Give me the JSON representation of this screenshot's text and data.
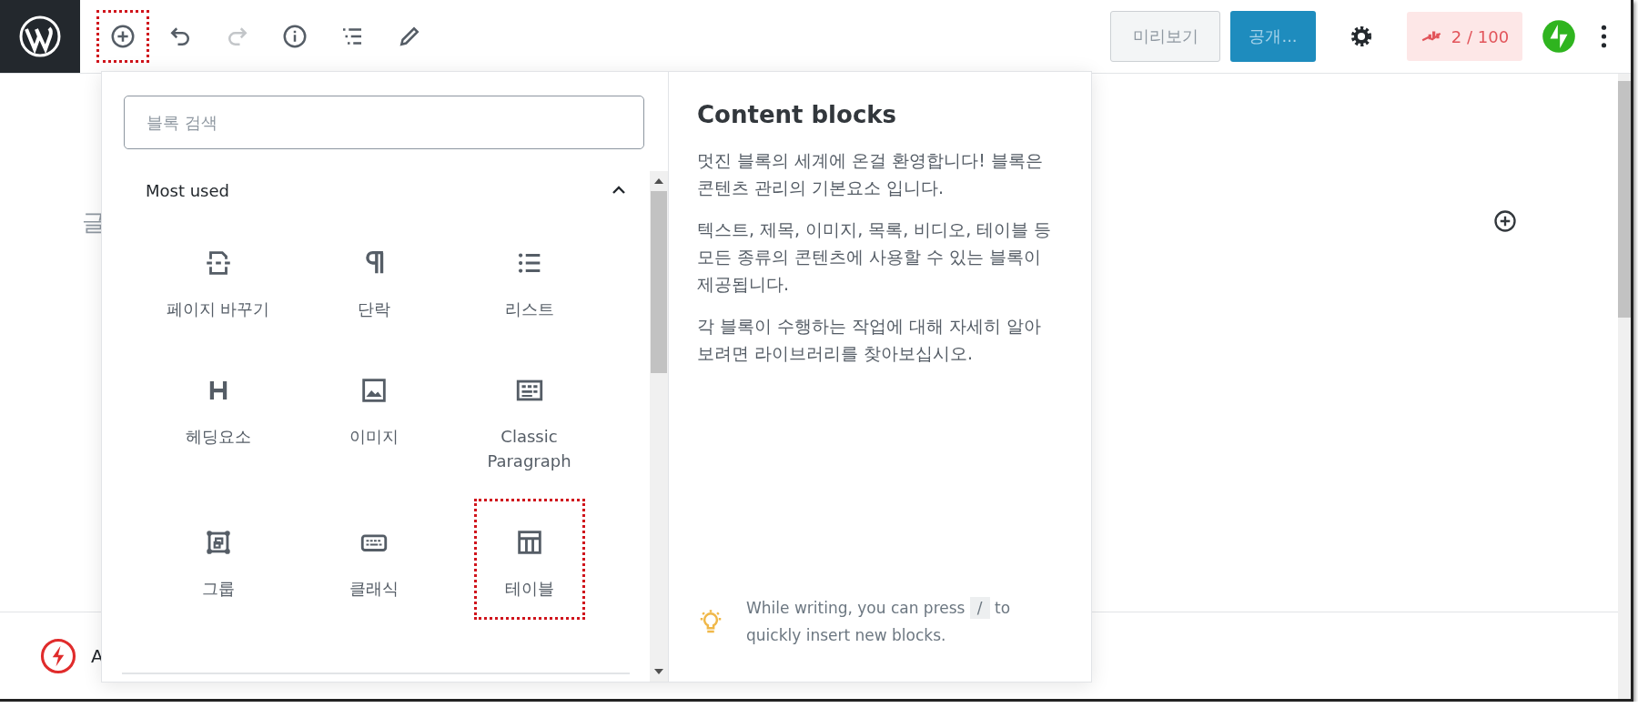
{
  "toolbar": {
    "tools": [
      {
        "kind": "inserter",
        "highlighted": true,
        "disabled": false
      },
      {
        "kind": "undo",
        "highlighted": false,
        "disabled": false
      },
      {
        "kind": "redo",
        "highlighted": false,
        "disabled": true
      },
      {
        "kind": "info",
        "highlighted": false,
        "disabled": false
      },
      {
        "kind": "outline",
        "highlighted": false,
        "disabled": false
      },
      {
        "kind": "edit",
        "highlighted": false,
        "disabled": false
      }
    ],
    "preview_button": "미리보기",
    "publish_button": "공개...",
    "seo_score": "2 / 100"
  },
  "editor": {
    "side_text": "글",
    "footer_text": "A"
  },
  "inserter": {
    "search": {
      "placeholder": "블록 검색"
    },
    "category": {
      "title": "Most used",
      "expanded": true
    },
    "blocks": [
      {
        "kind": "page-break",
        "label": "페이지 바꾸기",
        "highlighted": false
      },
      {
        "kind": "paragraph",
        "label": "단락",
        "highlighted": false
      },
      {
        "kind": "list",
        "label": "리스트",
        "highlighted": false
      },
      {
        "kind": "heading",
        "label": "헤딩요소",
        "highlighted": false
      },
      {
        "kind": "image",
        "label": "이미지",
        "highlighted": false
      },
      {
        "kind": "classic",
        "label": "Classic Paragraph",
        "highlighted": false
      },
      {
        "kind": "group",
        "label": "그룹",
        "highlighted": false
      },
      {
        "kind": "keyboard",
        "label": "클래식",
        "highlighted": false
      },
      {
        "kind": "table",
        "label": "테이블",
        "highlighted": true
      }
    ],
    "preview": {
      "title": "Content blocks",
      "paragraphs": [
        "멋진 블록의 세계에 온걸 환영합니다! 블록은 콘텐츠 관리의 기본요소 입니다.",
        "텍스트, 제목, 이미지, 목록, 비디오, 테이블 등 모든 종류의 콘텐츠에 사용할 수 있는 블록이 제공됩니다.",
        "각 블록이 수행하는 작업에 대해 자세히 알아 보려면 라이브러리를 찾아보십시오."
      ],
      "tip": {
        "before": "While writing, you can press",
        "key": "/",
        "after": "to quickly insert new blocks."
      }
    }
  }
}
